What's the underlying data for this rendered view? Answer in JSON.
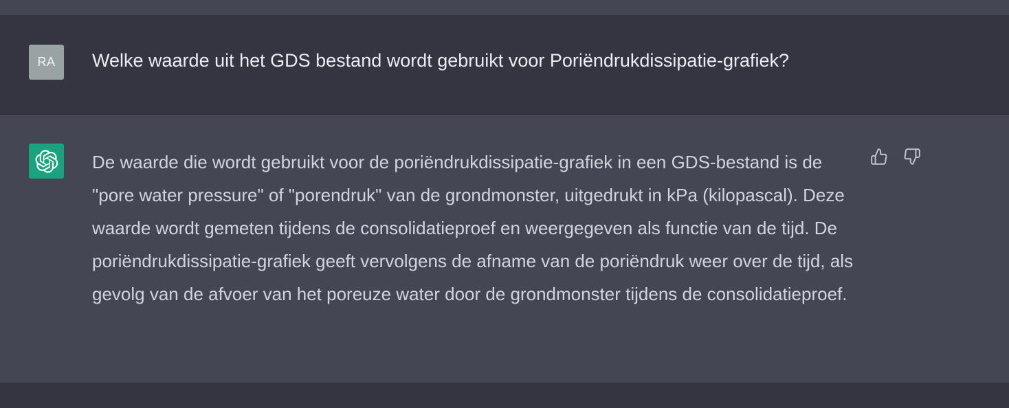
{
  "conversation": {
    "user_message": {
      "avatar_initials": "RA",
      "text": "Welke waarde uit het GDS bestand wordt gebruikt voor Poriëndrukdissipatie-grafiek?"
    },
    "assistant_message": {
      "avatar_icon": "openai-logo-icon",
      "text": "De waarde die wordt gebruikt voor de poriëndrukdissipatie-grafiek in een GDS-bestand is de \"pore water pressure\" of \"porendruk\" van de grondmonster, uitgedrukt in kPa (kilopascal). Deze waarde wordt gemeten tijdens de consolidatieproef en weergegeven als functie van de tijd. De poriëndrukdissipatie-grafiek geeft vervolgens de afname van de poriëndruk weer over de tijd, als gevolg van de afvoer van het poreuze water door de grondmonster tijdens de consolidatieproef.",
      "feedback_icons": [
        "thumbs-up-icon",
        "thumbs-down-icon"
      ]
    }
  },
  "colors": {
    "user_bg": "#343541",
    "assistant_bg": "#444654",
    "bot_avatar": "#19a37f",
    "user_avatar": "#9aa3a3",
    "text": "#ececf1",
    "assistant_text": "#d1d5db"
  }
}
